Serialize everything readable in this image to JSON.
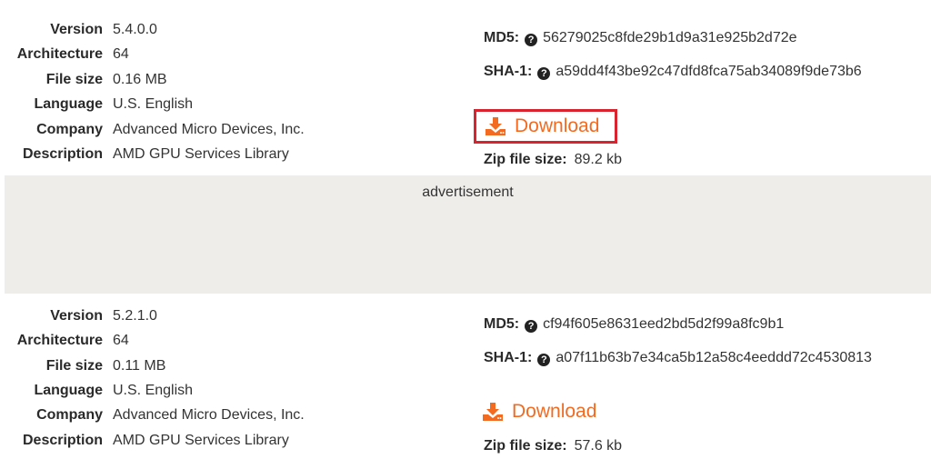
{
  "versions": [
    {
      "info": [
        {
          "label": "Version",
          "value": "5.4.0.0"
        },
        {
          "label": "Architecture",
          "value": "64"
        },
        {
          "label": "File size",
          "value": "0.16 MB"
        },
        {
          "label": "Language",
          "value": "U.S. English"
        },
        {
          "label": "Company",
          "value": "Advanced Micro Devices, Inc."
        },
        {
          "label": "Description",
          "value": "AMD GPU Services Library"
        }
      ],
      "md5_label": "MD5:",
      "md5": "56279025c8fde29b1d9a31e925b2d72e",
      "sha1_label": "SHA-1:",
      "sha1": "a59dd4f43be92c47dfd8fca75ab34089f9de73b6",
      "download_label": "Download",
      "zip_label": "Zip file size:",
      "zip_size": "89.2 kb"
    },
    {
      "info": [
        {
          "label": "Version",
          "value": "5.2.1.0"
        },
        {
          "label": "Architecture",
          "value": "64"
        },
        {
          "label": "File size",
          "value": "0.11 MB"
        },
        {
          "label": "Language",
          "value": "U.S. English"
        },
        {
          "label": "Company",
          "value": "Advanced Micro Devices, Inc."
        },
        {
          "label": "Description",
          "value": "AMD GPU Services Library"
        }
      ],
      "md5_label": "MD5:",
      "md5": "cf94f605e8631eed2bd5d2f99a8fc9b1",
      "sha1_label": "SHA-1:",
      "sha1": "a07f11b63b7e34ca5b12a58c4eeddd72c4530813",
      "download_label": "Download",
      "zip_label": "Zip file size:",
      "zip_size": "57.6 kb"
    }
  ],
  "advertisement": {
    "label": "advertisement"
  },
  "icons": {
    "help": "question-circle-icon",
    "download": "download-tray-icon"
  },
  "colors": {
    "accent": "#f26b21",
    "highlight_border": "#d9232e",
    "ad_background": "#efedea"
  }
}
